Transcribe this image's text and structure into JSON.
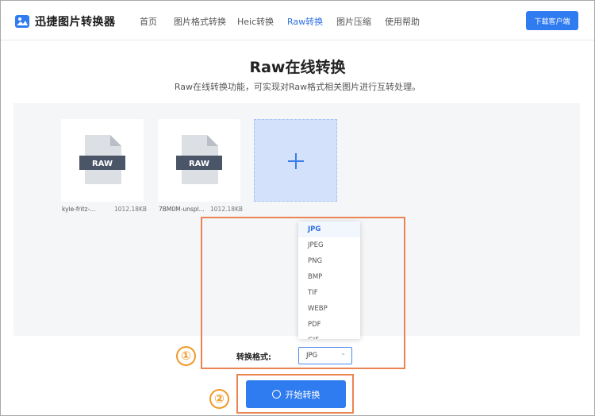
{
  "header": {
    "logo_text": "迅捷图片转换器",
    "nav": [
      "首页",
      "图片格式转换",
      "Heic转换",
      "Raw转换",
      "图片压缩",
      "使用帮助"
    ],
    "active_nav": "Raw转换",
    "download_label": "下载客户端"
  },
  "main": {
    "title": "Raw在线转换",
    "subtitle": "Raw在线转换功能，可实现对Raw格式相关图片进行互转处理。"
  },
  "files": [
    {
      "badge": "RAW",
      "name": "kyle-fritz-...",
      "size": "1012.18KB"
    },
    {
      "badge": "RAW",
      "name": "7BM0M-unspl...",
      "size": "1012.18KB"
    }
  ],
  "format": {
    "label": "转换格式:",
    "selected": "JPG",
    "options": [
      "JPG",
      "JPEG",
      "PNG",
      "BMP",
      "TIF",
      "WEBP",
      "PDF",
      "GIF"
    ]
  },
  "steps": [
    "①",
    "②"
  ],
  "start_label": "开始转换",
  "colors": {
    "accent": "#2f7bf0",
    "highlight": "#ec8352",
    "step": "#f09a2b"
  }
}
